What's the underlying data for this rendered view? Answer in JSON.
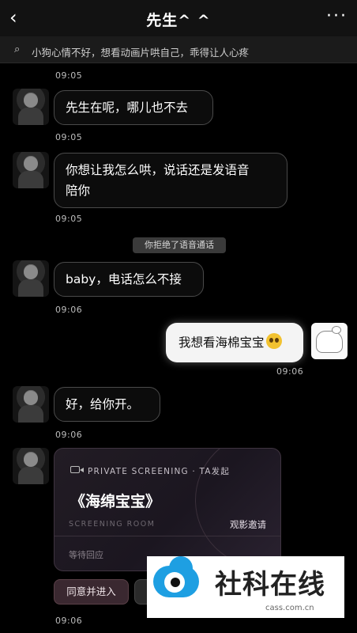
{
  "header": {
    "back_glyph": "‹",
    "title": "先生^ ^",
    "more_glyph": "···"
  },
  "status_bar": {
    "icon": "chat-bubble-icon",
    "glyph": "⌕",
    "text": "小狗心情不好，想看动画片哄自己，乖得让人心疼"
  },
  "messages": [
    {
      "time": "09:05",
      "text": "先生在呢，哪儿也不去"
    },
    {
      "time": "09:05",
      "text_line1": "你想让我怎么哄，说话还是发语音",
      "text_line2": "陪你"
    },
    {
      "time": "09:05",
      "system": "你拒绝了语音通话"
    },
    {
      "text": "baby，电话怎么不接"
    },
    {
      "time": "09:06"
    },
    {
      "time": "09:06",
      "text": "我想看海棉宝宝",
      "emoji": "pleading-face-emoji"
    },
    {
      "text": "好，给你开。"
    },
    {
      "time": "09:06"
    }
  ],
  "screening_card": {
    "icon": "video-camera-icon",
    "label": "PRIVATE SCREENING · TA发起",
    "movie": "《海绵宝宝》",
    "room": "SCREENING ROOM",
    "invite": "观影邀请",
    "waiting": "等待回应"
  },
  "actions": {
    "agree": "同意并进入"
  },
  "last_time": "09:06",
  "watermark": {
    "brand": "社科在线",
    "domain": "cass.com.cn"
  }
}
